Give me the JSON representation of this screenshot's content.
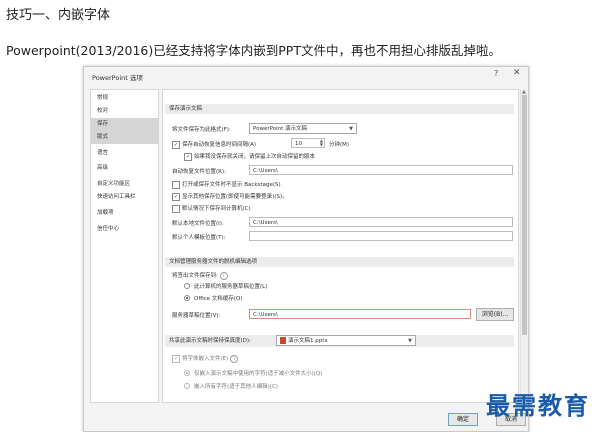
{
  "article": {
    "heading": "技巧一、内嵌字体",
    "paragraph": "Powerpoint(2013/2016)已经支持将字体内嵌到PPT文件中，再也不用担心排版乱掉啦。"
  },
  "dialog": {
    "title": "PowerPoint 选项",
    "help": "?",
    "close": "✕",
    "sidebar": [
      "常规",
      "校对",
      "保存",
      "版式",
      "语言",
      "高级",
      "自定义功能区",
      "快速访问工具栏",
      "加载项",
      "信任中心"
    ],
    "save_section": {
      "header": "保存演示文稿",
      "format_label": "将文件保存为此格式(F):",
      "format_value": "PowerPoint 演示文稿",
      "autorecover_label": "保存自动恢复信息时间间隔(A)",
      "autorecover_minutes": "10",
      "minutes_label": "分钟(M)",
      "keep_last_label": "如果我没保存就关闭，请保留上次自动保留的版本",
      "autorecover_location_label": "自动恢复文件位置(R):",
      "autorecover_location_value": "C:\\Users\\",
      "no_backstage_label": "打开或保存文件时不显示 Backstage(S)",
      "show_additional_label": "显示其他保存位置(即使可能需要登录)(S)。",
      "default_computer_label": "默认情况下保存到计算机(C)",
      "default_local_label": "默认本地文件位置(I):",
      "default_local_value": "C:\\Users\\",
      "default_template_label": "默认个人模板位置(T):",
      "default_template_value": ""
    },
    "offline_section": {
      "header": "文档管理服务器文件的脱机编辑选项",
      "checked_out_label": "将签出文件保存到:",
      "opt_server_drafts": "此计算机的服务器草稿位置(L)",
      "opt_office_cache": "Office 文档缓存(O)",
      "server_drafts_label": "服务器草稿位置(V):",
      "server_drafts_value": "C:\\Users\\",
      "browse_button": "浏览(B)..."
    },
    "fidelity_section": {
      "header": "共享此演示文稿时保持保真度(D):",
      "file_value": "演示文稿1.pptx",
      "embed_fonts_label": "将字体嵌入文件(E)",
      "opt_used_chars": "仅嵌入演示文稿中使用的字符(适于减小文件大小)(Q)",
      "opt_all_chars": "嵌入所有字符(适于其他人编辑)(C)"
    },
    "ok_button": "确定",
    "cancel_button": "取消"
  },
  "watermark": "最需教育"
}
